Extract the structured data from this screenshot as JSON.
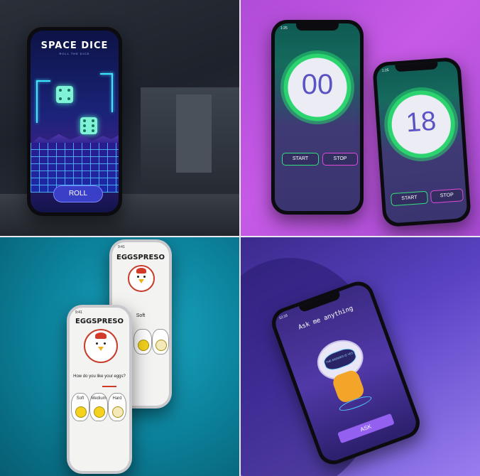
{
  "space_dice": {
    "title": "SPACE DICE",
    "subtitle": "ROLL THE DICE",
    "roll_label": "ROLL",
    "accent": "#3fe6ff"
  },
  "timer": {
    "phone1_status": "1:25",
    "phone2_status": "1:25",
    "phone1_value": "00",
    "phone2_value": "18",
    "start_label": "START",
    "stop_label": "STOP",
    "start_color": "#34e07d",
    "stop_color": "#e049d6"
  },
  "eggspreso": {
    "title": "EGGSPRESO",
    "back_status": "9:41",
    "front_status": "9:41",
    "back_selected": "Soft",
    "question": "How do you like your eggs?",
    "options": [
      "Soft",
      "Medium",
      "Hard"
    ]
  },
  "ask": {
    "status": "12:16",
    "title": "Ask me anything",
    "visor_text": "THE ANSWER IS YES",
    "button_label": "ASK"
  }
}
